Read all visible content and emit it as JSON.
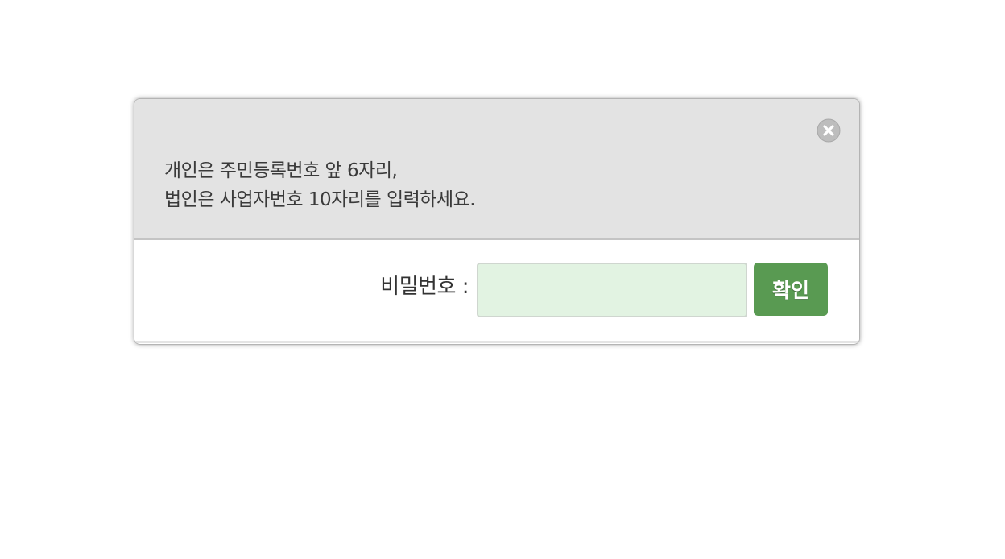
{
  "dialog": {
    "close_icon": "close-circle-icon",
    "message_lines": [
      "개인은 주민등록번호 앞 6자리,",
      "법인은 사업자번호 10자리를 입력하세요."
    ],
    "password_label": "비밀번호 :",
    "password_value": "",
    "password_placeholder": "",
    "confirm_label": "확인"
  },
  "colors": {
    "header_bg": "#e3e3e3",
    "input_bg": "#e2f3e2",
    "button_bg": "#599a52",
    "close_icon": "#b8b8b8"
  }
}
